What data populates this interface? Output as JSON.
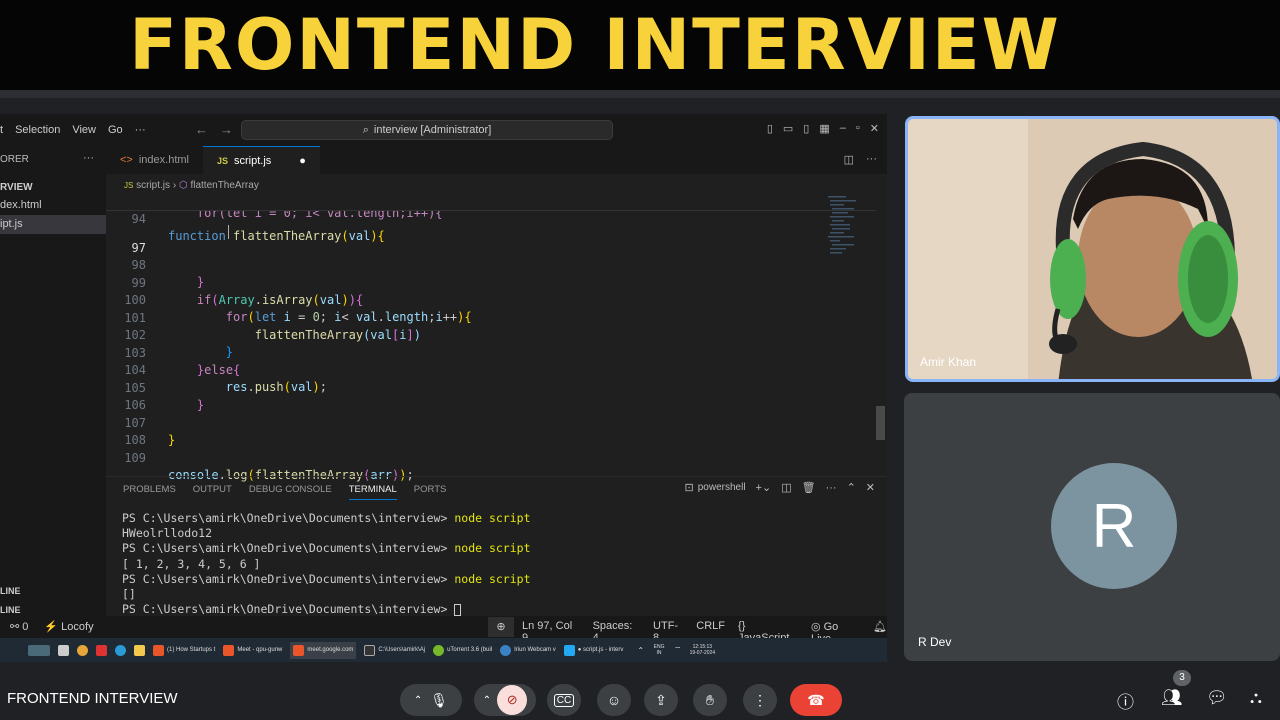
{
  "banner": {
    "title": "FRONTEND INTERVIEW"
  },
  "vscode": {
    "menu": [
      "t",
      "Selection",
      "View",
      "Go",
      "···"
    ],
    "command_center": "interview [Administrator]",
    "sidebar": {
      "header": "ORER",
      "section": "RVIEW",
      "files": [
        "dex.html",
        "ipt.js"
      ],
      "bottom": [
        "LINE",
        "LINE"
      ]
    },
    "tabs": [
      {
        "label": "index.html",
        "icon": "<>"
      },
      {
        "label": "script.js",
        "icon": "JS"
      }
    ],
    "breadcrumb": {
      "file": "script.js",
      "symbol": "flattenTheArray"
    },
    "sticky_header": {
      "ln": "94",
      "text": "function flattenTheArray(val){"
    },
    "code_lines": [
      {
        "ln": "96",
        "text": "    for(let i = 0; i< val.length;i++){"
      },
      {
        "ln": "97",
        "text": ""
      },
      {
        "ln": "98",
        "text": "    }"
      },
      {
        "ln": "99",
        "text": "    if(Array.isArray(val)){"
      },
      {
        "ln": "100",
        "text": "        for(let i = 0; i< val.length;i++){"
      },
      {
        "ln": "101",
        "text": "            flattenTheArray(val[i])"
      },
      {
        "ln": "102",
        "text": "        }"
      },
      {
        "ln": "103",
        "text": "    }else{"
      },
      {
        "ln": "104",
        "text": "        res.push(val);"
      },
      {
        "ln": "105",
        "text": "    }"
      },
      {
        "ln": "106",
        "text": ""
      },
      {
        "ln": "107",
        "text": "}"
      },
      {
        "ln": "108",
        "text": ""
      },
      {
        "ln": "109",
        "text": "console.log(flattenTheArray(arr));"
      }
    ],
    "panel_tabs": [
      "PROBLEMS",
      "OUTPUT",
      "DEBUG CONSOLE",
      "TERMINAL",
      "PORTS"
    ],
    "active_panel": "TERMINAL",
    "shell": "powershell",
    "terminal": [
      {
        "prompt": "PS C:\\Users\\amirk\\OneDrive\\Documents\\interview> ",
        "cmd": "node script"
      },
      {
        "prompt": "HWeolrllodo12",
        "cmd": ""
      },
      {
        "prompt": "PS C:\\Users\\amirk\\OneDrive\\Documents\\interview> ",
        "cmd": "node script"
      },
      {
        "prompt": "[ 1, 2, 3, 4, 5, 6 ]",
        "cmd": ""
      },
      {
        "prompt": "PS C:\\Users\\amirk\\OneDrive\\Documents\\interview> ",
        "cmd": "node script"
      },
      {
        "prompt": "[]",
        "cmd": ""
      },
      {
        "prompt": "PS C:\\Users\\amirk\\OneDrive\\Documents\\interview> ",
        "cmd": ""
      }
    ],
    "status": {
      "errors": "0",
      "locofy": "Locofy",
      "position": "Ln 97, Col 9",
      "spaces": "Spaces: 4",
      "encoding": "UTF-8",
      "eol": "CRLF",
      "language": "JavaScript",
      "golive": "Go Live"
    }
  },
  "taskbar": {
    "items": [
      "(1) How Startups t",
      "Meet - qpu-gunw",
      "meet.google.com",
      "C:\\Users\\amirk\\Aj",
      "uTorrent 3.6 (buil",
      "Iriun Webcam v",
      "● script.js - interv"
    ],
    "lang": "ENG IN",
    "time": "12:15:13",
    "date": "19-07-2024"
  },
  "meet": {
    "title": "FRONTEND INTERVIEW",
    "participants": [
      {
        "name": "Amir Khan"
      },
      {
        "name": "R Dev",
        "initial": "R"
      }
    ],
    "people_count": "3",
    "colors": {
      "end_call": "#ea4335",
      "active_border": "#8ab4f8",
      "avatar": "#7c94a0"
    }
  }
}
